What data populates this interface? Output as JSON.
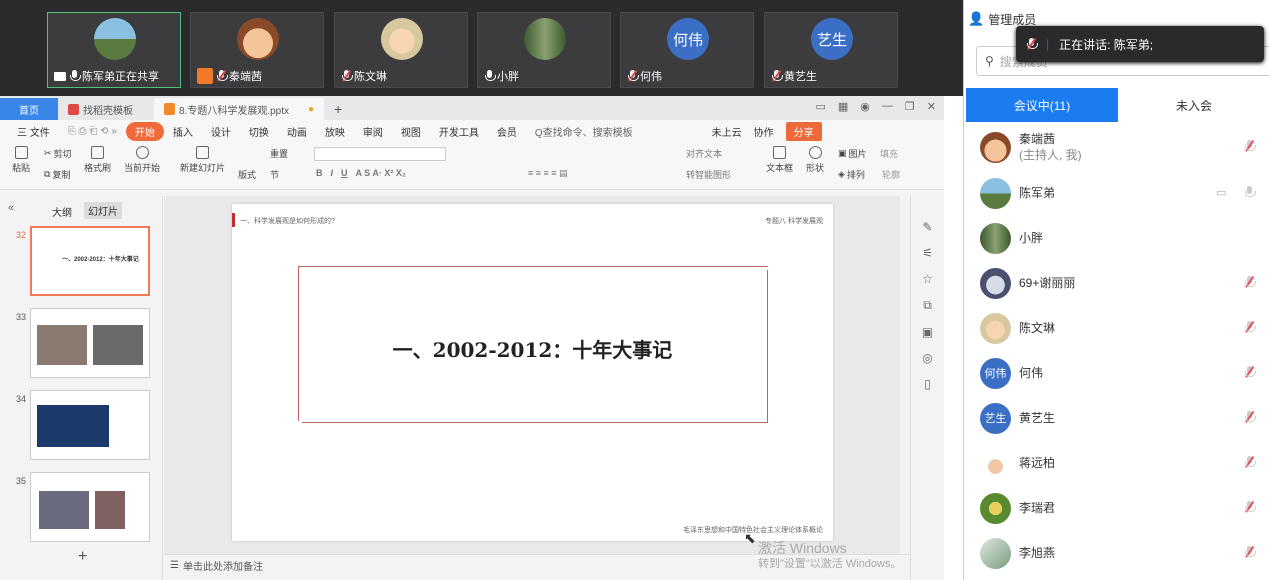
{
  "video_tiles": [
    {
      "name": "陈军弟正在共享",
      "sharing": true,
      "avatar": "photo-landscape"
    },
    {
      "name": "秦端茜",
      "avatar": "cartoon-face"
    },
    {
      "name": "陈文琳",
      "avatar": "cartoon-child"
    },
    {
      "name": "小胖",
      "avatar": "forest-photo"
    },
    {
      "name": "何伟",
      "avatar_text": "何伟"
    },
    {
      "name": "黄艺生",
      "avatar_text": "艺生"
    }
  ],
  "wps": {
    "tabs": {
      "home": "首页",
      "template": "找稻壳模板",
      "doc": "8.专题八科学发展观.pptx"
    },
    "menu": [
      "三 文件",
      "开始",
      "插入",
      "设计",
      "切换",
      "动画",
      "放映",
      "审阅",
      "视图",
      "开发工具",
      "会员"
    ],
    "menu_search": "Q查找命令、搜索模板",
    "cloud": "未上云",
    "collab": "协作",
    "share": "分享",
    "ribbon": {
      "paste": "粘贴",
      "cut": "剪切",
      "copy": "复制",
      "format_painter": "格式刷",
      "play": "当前开始",
      "new_slide": "新建幻灯片",
      "layout": "版式",
      "section": "节",
      "reset": "重置",
      "textbox": "文本框",
      "shape": "形状",
      "picture": "图片",
      "fill": "填充",
      "arrange": "排列",
      "outline": "轮廓",
      "align_text": "对齐文本",
      "smart_graphic": "转智能图形"
    },
    "left_tabs": {
      "outline": "大纲",
      "slides": "幻灯片"
    },
    "thumbs": [
      "32",
      "33",
      "34",
      "35"
    ],
    "slide": {
      "header": "一、科学发展观是如何形成的?",
      "topic": "专题八 科学发展观",
      "title": "一、2002-2012：十年大事记",
      "footer": "毛泽东思想和中国特色社会主义理论体系概论"
    },
    "notes": "单击此处添加备注"
  },
  "panel": {
    "title": "管理成员",
    "search_placeholder": "搜索成员",
    "tab_in": "会议中(11)",
    "tab_out": "未入会",
    "members": [
      {
        "name": "秦端茜",
        "sub": "(主持人, 我)"
      },
      {
        "name": "陈军弟"
      },
      {
        "name": "小胖"
      },
      {
        "name": "69+谢丽丽"
      },
      {
        "name": "陈文琳"
      },
      {
        "name": "何伟",
        "avatar_text": "何伟"
      },
      {
        "name": "黄艺生",
        "avatar_text": "艺生"
      },
      {
        "name": "蒋远柏"
      },
      {
        "name": "李瑞君"
      },
      {
        "name": "李旭燕"
      }
    ]
  },
  "speaking": {
    "label": "正在讲话: ",
    "name": "陈军弟;"
  },
  "watermark": {
    "line1": "激活 Windows",
    "line2": "转到\"设置\"以激活 Windows。"
  }
}
